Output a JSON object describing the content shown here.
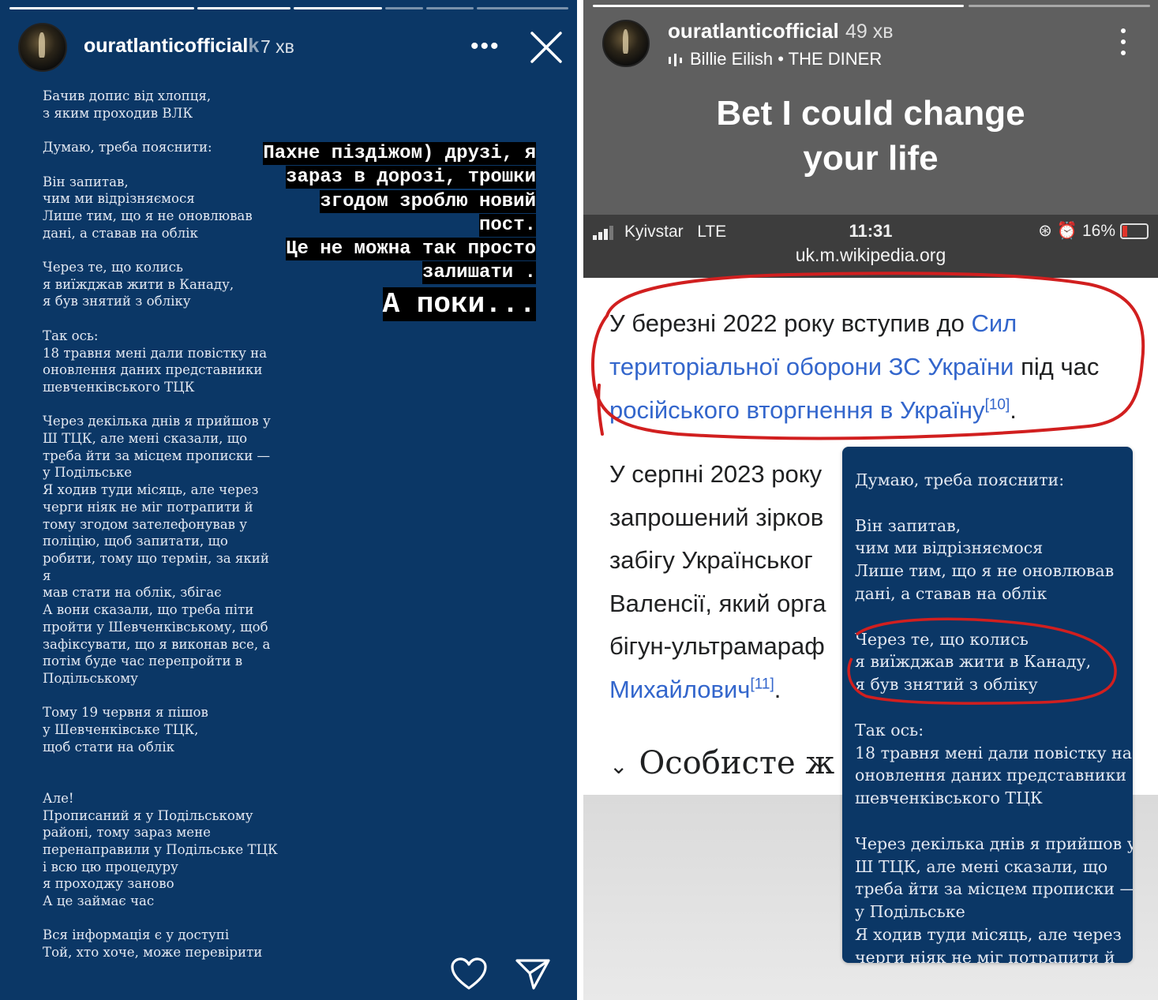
{
  "left_story": {
    "username": "ouratlanticofficial",
    "username_overlap": "ouratlanticofficialk",
    "time": "7 хв",
    "more_label": "•••",
    "body_text": "Бачив допис від хлопця,\nз яким проходив ВЛК\n\nДумаю, треба пояснити:\n\nВін запитав,\nчим ми відрізняємося\nЛише тим, що я не оновлював\nдані, а ставав на облік\n\nЧерез те, що колись\nя виїжджав жити в Канаду,\nя був знятий з обліку\n\nТак ось:\n18 травня мені дали повістку на\nоновлення даних представники\nшевченківського ТЦК\n\nЧерез декілька днів я прийшов у\nШ ТЦК, але мені сказали, що\nтреба йти за місцем прописки —\nу Подільське\nЯ ходив туди місяць, але через\nчерги ніяк не міг потрапити й\nтому згодом зателефонував у\nполіцію, щоб запитати, що\nробити, тому що термін, за який я\nмав стати на облік, збігає\nА вони сказали, що треба піти\nпройти у Шевченківському, щоб\nзафіксувати, що я виконав все, а\nпотім буде час перепройти в\nПодільському\n\nТому 19 червня я пішов\nу Шевченківське ТЦК,\nщоб стати на облік\n\n\nАле!\nПрописаний я у Подільському\nрайоні, тому зараз мене\nперенаправили у Подільське ТЦК\nі всю цю процедуру\nя проходжу заново\nА це займає час\n\nВся інформація є у доступі\nТой, хто хоче, може перевірити",
    "overlay_lines": [
      "Пахне піздіжом) друзі, я",
      "зараз в дорозі, трошки",
      "згодом зроблю новий",
      "пост.",
      "Це не можна так просто",
      "залишати ."
    ],
    "overlay_big": "А поки..."
  },
  "right_story": {
    "username": "ouratlanticofficial",
    "time": "49 хв",
    "music": "Billie Eilish • THE DINER",
    "caption_line1": "Bet I could change",
    "caption_line2": "your life",
    "status_bar": {
      "carrier": "Kyivstar",
      "network": "LTE",
      "clock": "11:31",
      "battery": "16%",
      "url": "uk.m.wikipedia.org"
    },
    "wiki": {
      "p1_a": "У березні 2022 року вступив до ",
      "p1_link1": "Сил територіальної оборони ЗС України",
      "p1_b": " під час ",
      "p1_link2": "російського вторгнення в Україну",
      "p1_ref": "[10]",
      "p1_end": ".",
      "p2_lines": [
        "У серпні 2023 року",
        "запрошений зірков",
        "забігу Українськог",
        "Валенсії, який орга",
        "бігун-ультрамараф"
      ],
      "p2_link": "Михайлович",
      "p2_ref": "[11]",
      "p2_end": ".",
      "section_title": "Особисте ж"
    },
    "card_text": "Думаю, треба пояснити:\n\nВін запитав,\nчим ми відрізняємося\nЛише тим, що я не оновлював\nдані, а ставав на облік\n\nЧерез те, що колись\nя виїжджав жити в Канаду,\nя був знятий з обліку\n\nТак ось:\n18 травня мені дали повістку на\nоновлення даних представники\nшевченківського ТЦК\n\nЧерез декілька днів я прийшов у\nШ ТЦК, але мені сказали, що\nтреба йти за місцем прописки —\nу Подільське\nЯ ходив туди місяць, але через\nчерги ніяк не міг потрапити й"
  },
  "colors": {
    "story_blue": "#0b3766",
    "wiki_link": "#3366cc",
    "annotation_red": "#d11f1f"
  },
  "icons": [
    "close-icon",
    "heart-icon",
    "send-icon",
    "more-icon",
    "kebab-icon",
    "music-eq-icon",
    "signal-icon",
    "battery-icon",
    "chevron-down-icon"
  ]
}
